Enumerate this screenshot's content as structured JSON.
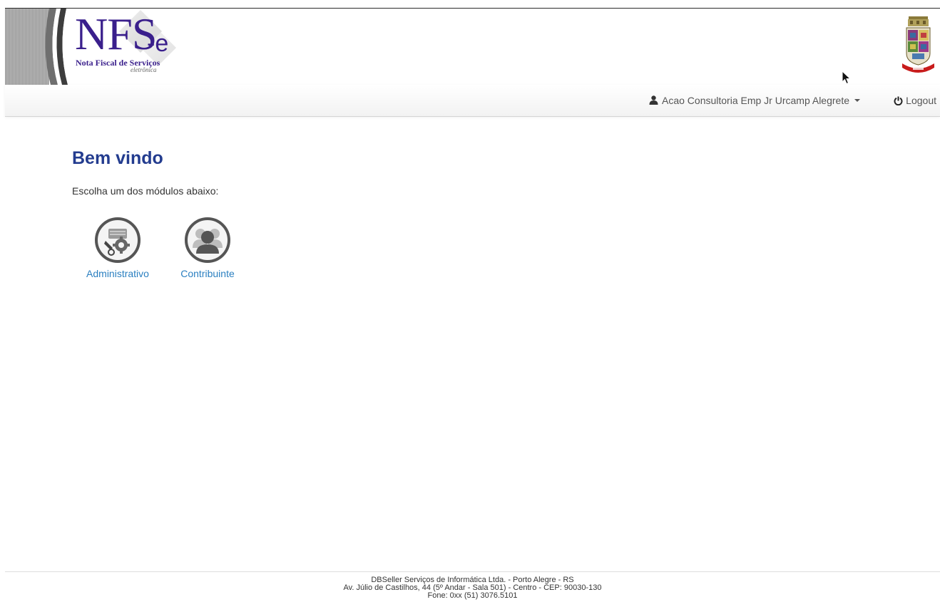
{
  "header": {
    "logo": {
      "brand_main": "NFS",
      "brand_suffix": "-e",
      "subtitle": "Nota Fiscal de Serviços",
      "tagline": "eletrônica"
    },
    "coat_of_arms_icon": "municipal-coat-of-arms"
  },
  "navbar": {
    "user_icon": "user-icon",
    "user_name": "Acao Consultoria Emp Jr Urcamp Alegrete",
    "logout_icon": "power-icon",
    "logout_label": "Logout"
  },
  "main": {
    "title": "Bem vindo",
    "subtitle": "Escolha um dos módulos abaixo:",
    "modules": [
      {
        "label": "Administrativo",
        "icon": "admin-gear-icon"
      },
      {
        "label": "Contribuinte",
        "icon": "users-icon"
      }
    ]
  },
  "footer": {
    "line1": "DBSeller Serviços de Informática Ltda. - Porto Alegre - RS",
    "line2": "Av. Júlio de Castilhos, 44 (5º Andar - Sala 501) - Centro - CEP: 90030-130",
    "line3": "Fone: 0xx (51) 3076.5101"
  },
  "colors": {
    "title": "#233c8f",
    "link": "#2a7fc0",
    "logo": "#3a1f8c"
  }
}
